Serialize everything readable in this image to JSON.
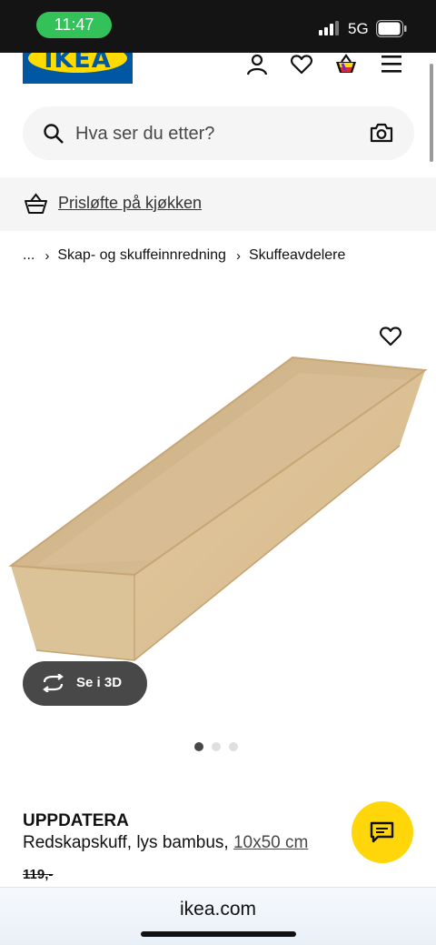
{
  "status_bar": {
    "time": "11:47",
    "network": "5G"
  },
  "header": {
    "logo_text": "IKEA"
  },
  "search": {
    "placeholder": "Hva ser du etter?"
  },
  "promo": {
    "label": "Prisløfte på kjøkken"
  },
  "breadcrumb": {
    "items": [
      "...",
      "Skap- og skuffeinnredning",
      "Skuffeavdelere"
    ]
  },
  "media": {
    "view_3d_label": "Se i 3D",
    "carousel_count": 3,
    "carousel_active": 1
  },
  "product": {
    "name": "UPPDATERA",
    "description": "Redskapskuff, lys bambus,",
    "size": "10x50 cm",
    "old_price": "119,-"
  },
  "browser": {
    "url": "ikea.com"
  },
  "colors": {
    "ikea_blue": "#0058a3",
    "ikea_yellow": "#ffdb00",
    "chat_button": "#ffd60a",
    "status_time_pill": "#33c15a"
  },
  "icons": [
    "search-icon",
    "camera-icon",
    "profile-icon",
    "heart-icon",
    "basket-icon",
    "menu-icon",
    "rotate-3d-icon",
    "chat-icon"
  ]
}
